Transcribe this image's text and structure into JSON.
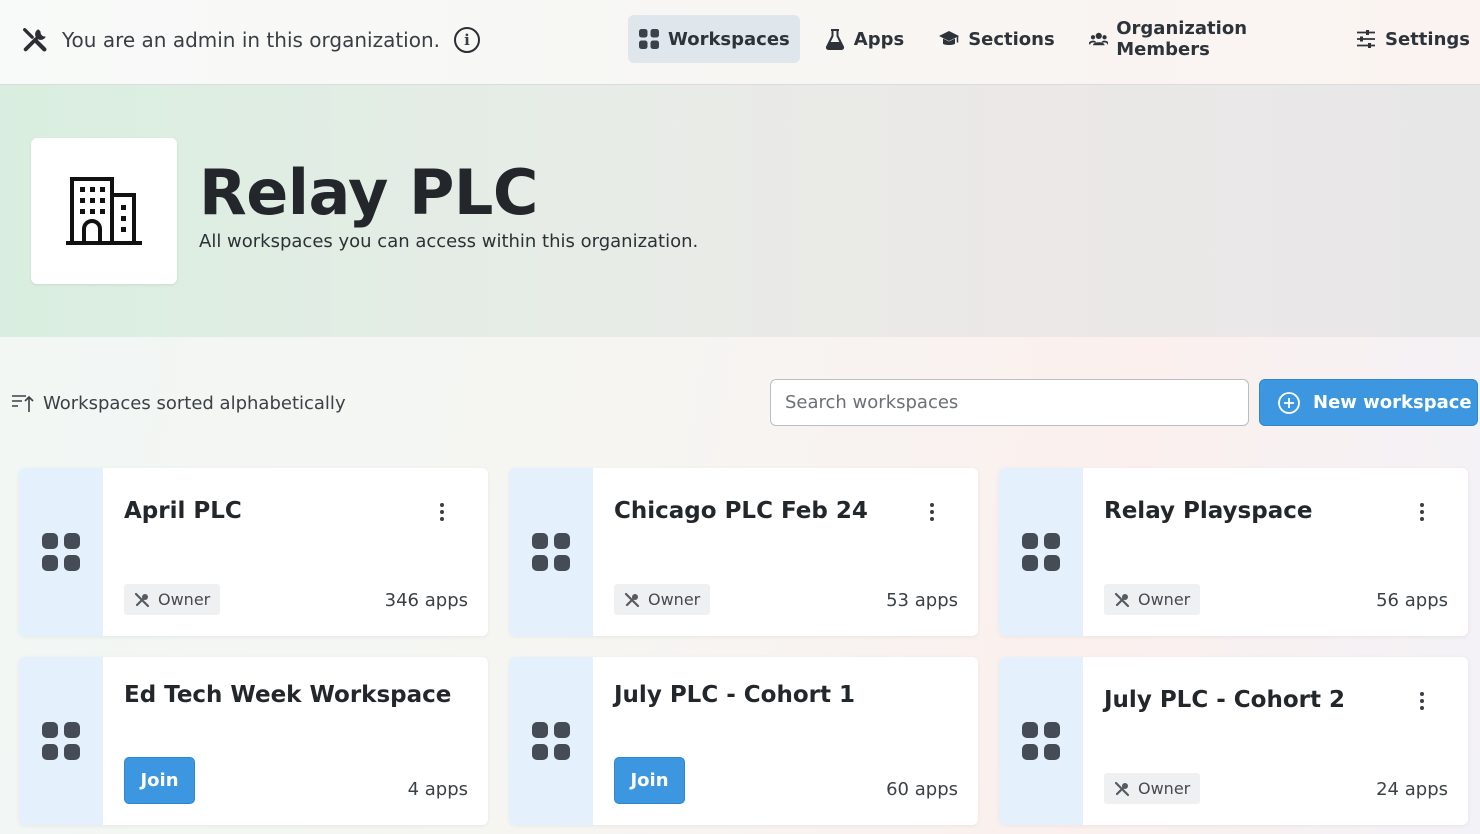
{
  "topbar": {
    "admin_note": "You are an admin in this organization.",
    "nav": [
      {
        "label": "Workspaces",
        "icon": "grid-icon",
        "active": true
      },
      {
        "label": "Apps",
        "icon": "flask-icon",
        "active": false
      },
      {
        "label": "Sections",
        "icon": "graduation-cap-icon",
        "active": false
      },
      {
        "label": "Organization Members",
        "icon": "users-icon",
        "active": false
      },
      {
        "label": "Settings",
        "icon": "sliders-icon",
        "active": false
      }
    ]
  },
  "org": {
    "name": "Relay PLC",
    "subtitle": "All workspaces you can access within this organization.",
    "logo_icon": "building-icon"
  },
  "toolbar": {
    "sort_label": "Workspaces sorted alphabetically",
    "search_placeholder": "Search workspaces",
    "new_button_label": "New workspace"
  },
  "workspaces": [
    {
      "name": "April PLC",
      "role": "Owner",
      "apps": "346 apps",
      "has_menu": true
    },
    {
      "name": "Chicago PLC Feb 24",
      "role": "Owner",
      "apps": "53 apps",
      "has_menu": true
    },
    {
      "name": "Relay Playspace",
      "role": "Owner",
      "apps": "56 apps",
      "has_menu": true
    },
    {
      "name": "Ed Tech Week Workspace",
      "join_label": "Join",
      "apps": "4 apps",
      "has_menu": false
    },
    {
      "name": "July PLC - Cohort 1",
      "join_label": "Join",
      "apps": "60 apps",
      "has_menu": false
    },
    {
      "name": "July PLC - Cohort 2",
      "role": "Owner",
      "apps": "24 apps",
      "has_menu": true
    }
  ],
  "colors": {
    "accent": "#3d97e0",
    "card_strip": "#e4f1fd",
    "active_nav": "#dfe6ec",
    "icon_dark": "#454c55"
  }
}
